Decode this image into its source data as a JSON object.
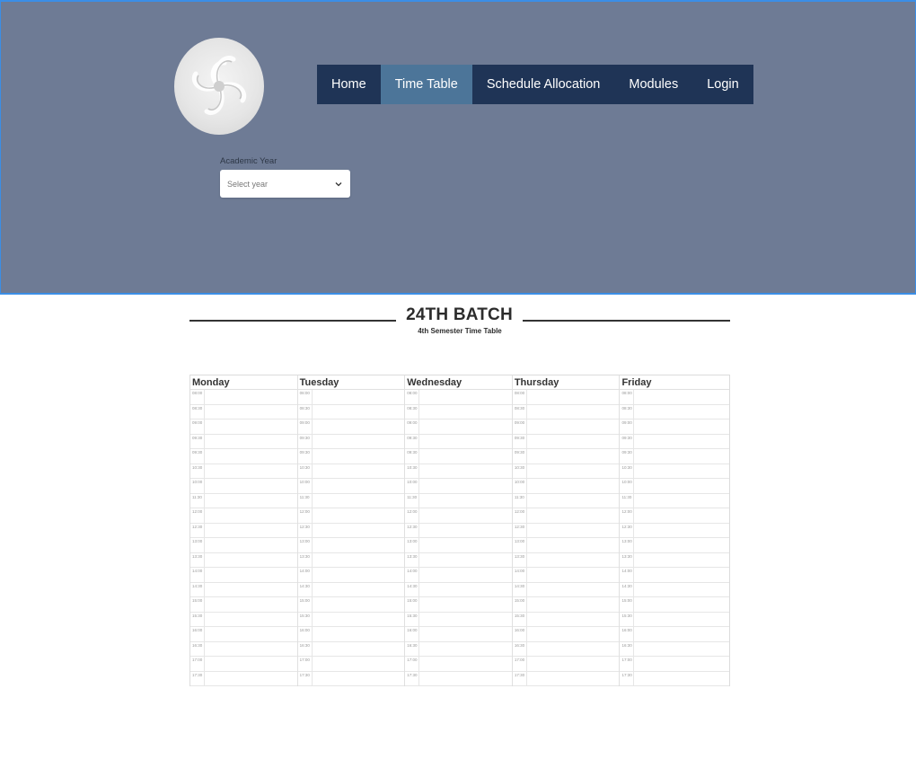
{
  "nav": {
    "items": [
      {
        "label": "Home",
        "active": false
      },
      {
        "label": "Time Table",
        "active": true
      },
      {
        "label": "Schedule Allocation",
        "active": false
      },
      {
        "label": "Modules",
        "active": false
      },
      {
        "label": "Login",
        "active": false
      }
    ]
  },
  "filter": {
    "label": "Academic Year",
    "placeholder": "Select year"
  },
  "heading": {
    "title": "24TH BATCH",
    "subtitle": "4th Semester Time Table"
  },
  "timetable": {
    "days": [
      "Monday",
      "Tuesday",
      "Wednesday",
      "Thursday",
      "Friday"
    ],
    "times": [
      "08:00",
      "08:30",
      "09:00",
      "09:30",
      "09:30",
      "10:30",
      "10:00",
      "11:30",
      "12:00",
      "12:30",
      "13:00",
      "13:30",
      "14:00",
      "14:30",
      "15:00",
      "15:30",
      "16:00",
      "16:30",
      "17:00",
      "17:30"
    ]
  },
  "colors": {
    "hero_bg": "#6e7b95",
    "nav_bg": "#1f3456",
    "nav_active": "#4c7599",
    "hero_border": "#3b8ee6"
  }
}
